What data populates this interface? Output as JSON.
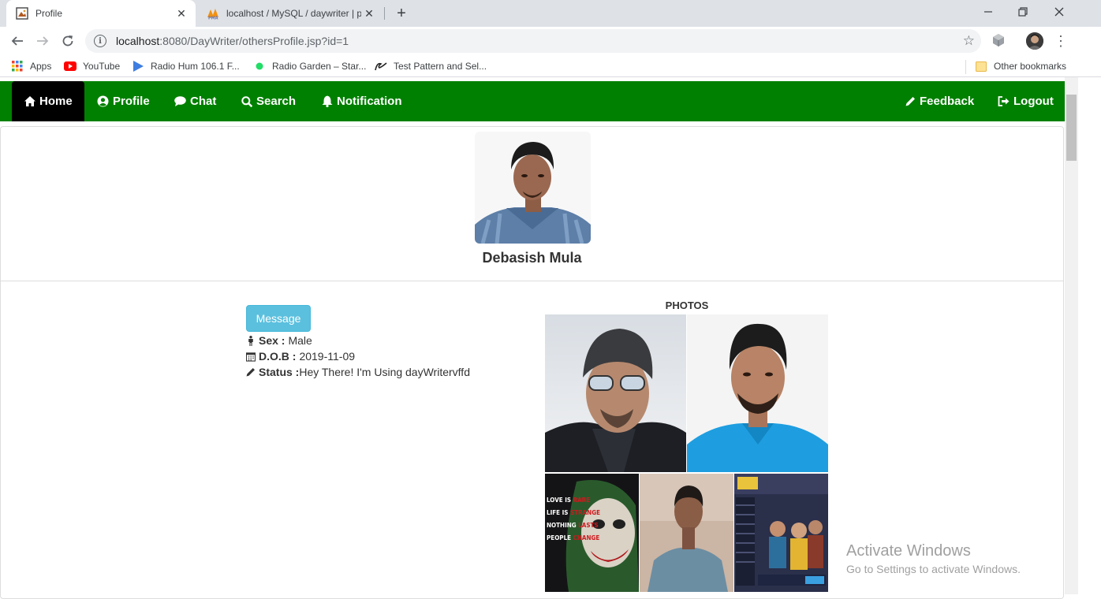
{
  "browser": {
    "tabs": [
      {
        "title": "Profile",
        "active": true
      },
      {
        "title": "localhost / MySQL / daywriter | p",
        "active": false
      }
    ],
    "url_host": "localhost",
    "url_rest": ":8080/DayWriter/othersProfile.jsp?id=1",
    "bookmarks": [
      {
        "label": "Apps",
        "icon": "apps-grid-icon"
      },
      {
        "label": "YouTube",
        "icon": "youtube-icon"
      },
      {
        "label": "Radio Hum 106.1 F...",
        "icon": "play-triangle-icon"
      },
      {
        "label": "Radio Garden – Star...",
        "icon": "green-dot-icon"
      },
      {
        "label": "Test Pattern and Sel...",
        "icon": "signature-icon"
      }
    ],
    "other_bookmarks": "Other bookmarks"
  },
  "nav": {
    "home": "Home",
    "profile": "Profile",
    "chat": "Chat",
    "search": "Search",
    "notification": "Notification",
    "feedback": "Feedback",
    "logout": "Logout",
    "color": "#008000"
  },
  "profile": {
    "name": "Debasish Mula",
    "message_button": "Message",
    "sex_label": "Sex :",
    "sex": "Male",
    "dob_label": "D.O.B :",
    "dob": "2019-11-09",
    "status_label": "Status :",
    "status": "Hey There! I'm Using dayWritervffd"
  },
  "photos": {
    "title": "PHOTOS",
    "joker_lines": [
      {
        "a": "LOVE IS ",
        "b": "RARE"
      },
      {
        "a": "LIFE IS ",
        "b": "STRANGE"
      },
      {
        "a": "NOTHING ",
        "b": "LASTS"
      },
      {
        "a": "PEOPLE ",
        "b": "CHANGE"
      }
    ]
  },
  "watermark": {
    "line1": "Activate Windows",
    "line2": "Go to Settings to activate Windows."
  }
}
